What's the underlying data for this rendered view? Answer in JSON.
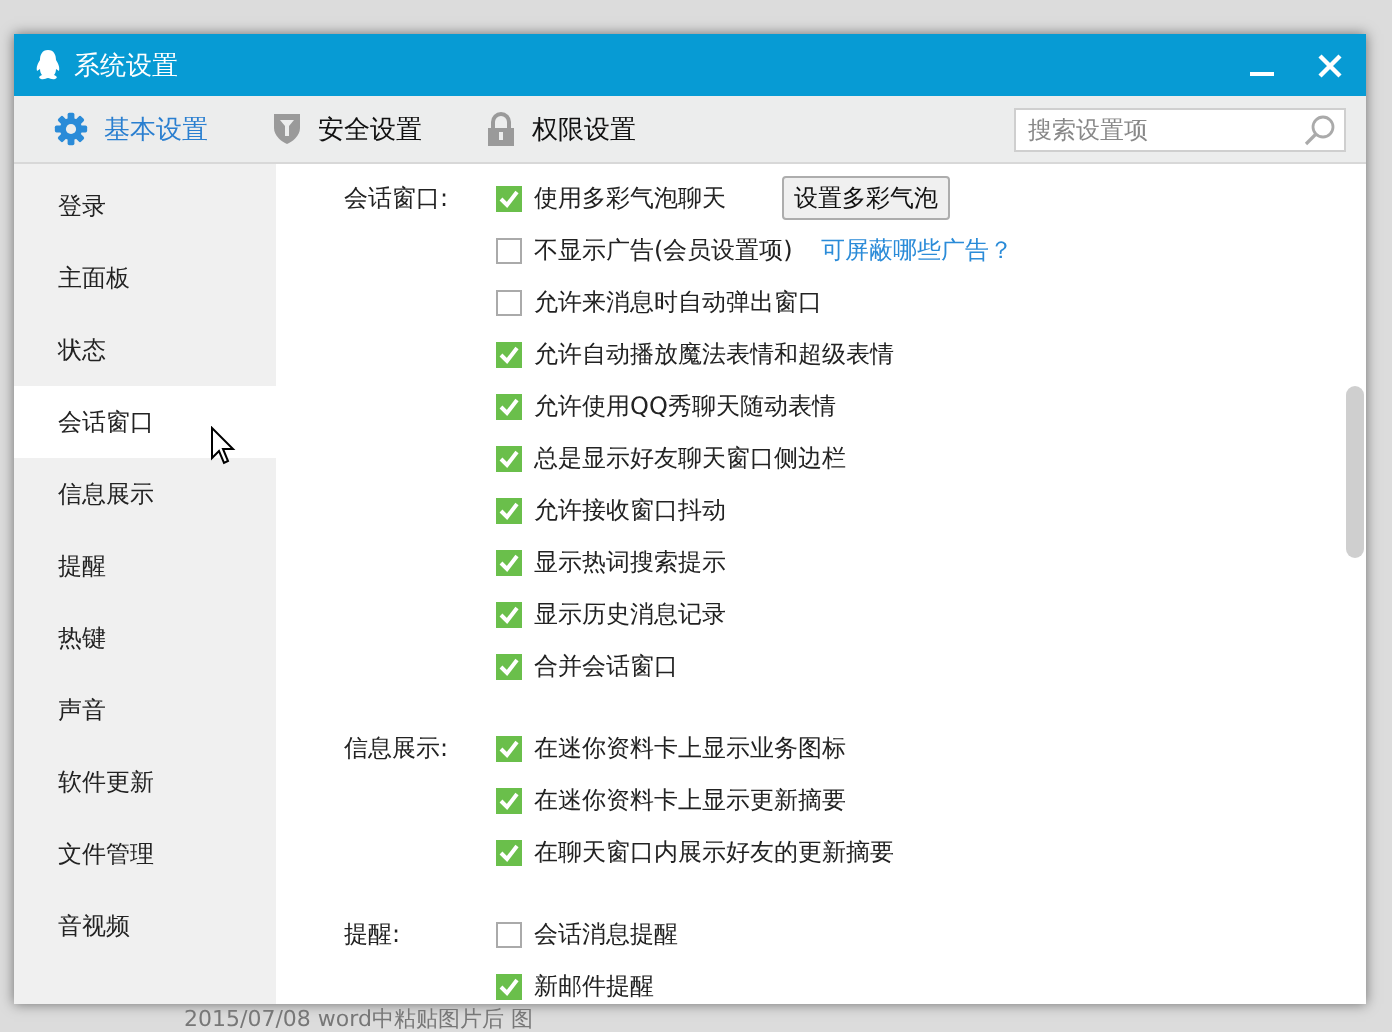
{
  "window": {
    "title": "系统设置"
  },
  "tabs": [
    {
      "label": "基本设置",
      "selected": true,
      "kind": "gear"
    },
    {
      "label": "安全设置",
      "selected": false,
      "kind": "shield"
    },
    {
      "label": "权限设置",
      "selected": false,
      "kind": "lock"
    }
  ],
  "search": {
    "placeholder": "搜索设置项"
  },
  "sidebar": {
    "items": [
      {
        "label": "登录",
        "selected": false
      },
      {
        "label": "主面板",
        "selected": false
      },
      {
        "label": "状态",
        "selected": false
      },
      {
        "label": "会话窗口",
        "selected": true
      },
      {
        "label": "信息展示",
        "selected": false
      },
      {
        "label": "提醒",
        "selected": false
      },
      {
        "label": "热键",
        "selected": false
      },
      {
        "label": "声音",
        "selected": false
      },
      {
        "label": "软件更新",
        "selected": false
      },
      {
        "label": "文件管理",
        "selected": false
      },
      {
        "label": "音视频",
        "selected": false
      }
    ]
  },
  "sections": [
    {
      "label": "会话窗口:",
      "options": [
        {
          "label": "使用多彩气泡聊天",
          "checked": true,
          "button": "设置多彩气泡"
        },
        {
          "label": "不显示广告(会员设置项)",
          "checked": false,
          "link": "可屏蔽哪些广告？"
        },
        {
          "label": "允许来消息时自动弹出窗口",
          "checked": false
        },
        {
          "label": "允许自动播放魔法表情和超级表情",
          "checked": true
        },
        {
          "label": "允许使用QQ秀聊天随动表情",
          "checked": true
        },
        {
          "label": "总是显示好友聊天窗口侧边栏",
          "checked": true
        },
        {
          "label": "允许接收窗口抖动",
          "checked": true
        },
        {
          "label": "显示热词搜索提示",
          "checked": true
        },
        {
          "label": "显示历史消息记录",
          "checked": true
        },
        {
          "label": "合并会话窗口",
          "checked": true
        }
      ]
    },
    {
      "label": "信息展示:",
      "options": [
        {
          "label": "在迷你资料卡上显示业务图标",
          "checked": true
        },
        {
          "label": "在迷你资料卡上显示更新摘要",
          "checked": true
        },
        {
          "label": "在聊天窗口内展示好友的更新摘要",
          "checked": true
        }
      ]
    },
    {
      "label": "提醒:",
      "options": [
        {
          "label": "会话消息提醒",
          "checked": false
        },
        {
          "label": "新邮件提醒",
          "checked": true
        }
      ]
    }
  ],
  "background_text": "2015/07/08  word中粘贴图片后  图"
}
